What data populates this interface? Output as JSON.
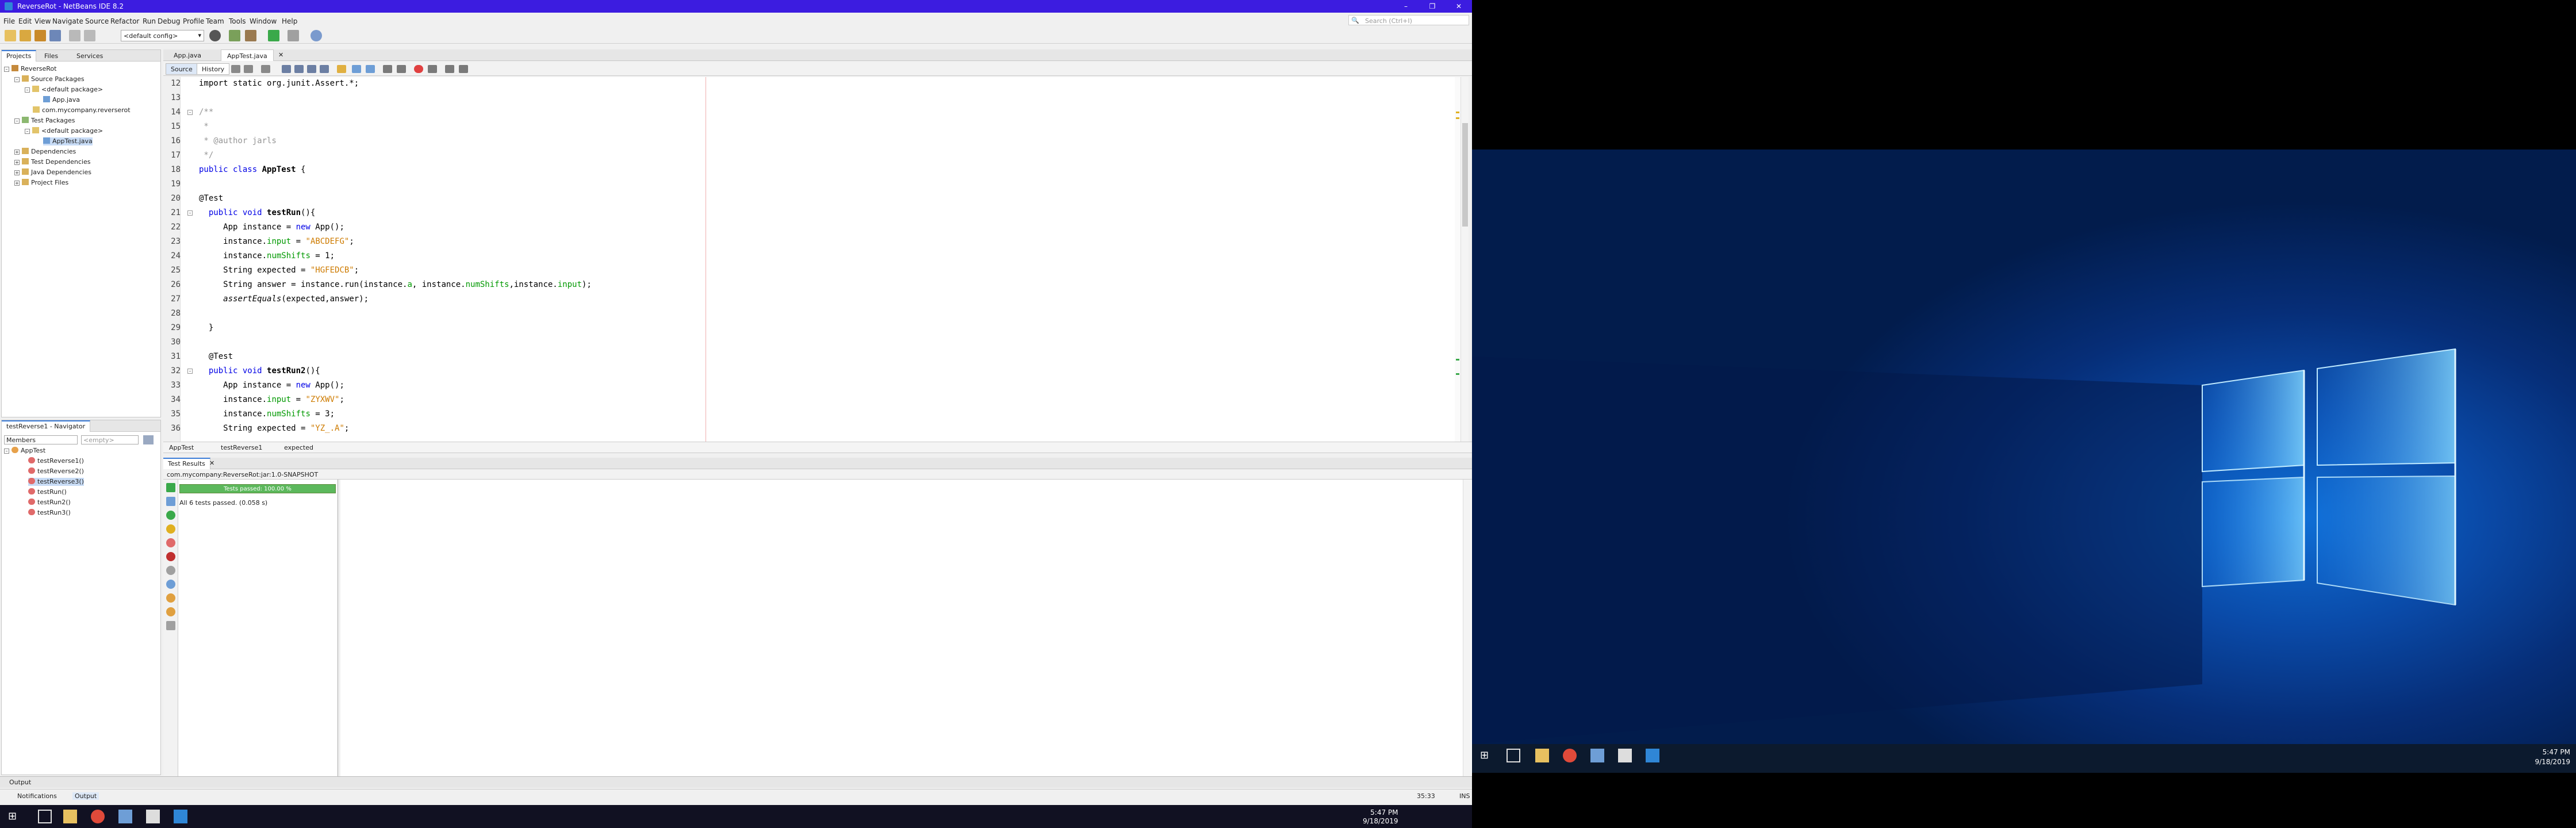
{
  "window": {
    "title": "ReverseRot - NetBeans IDE 8.2"
  },
  "menu": [
    "File",
    "Edit",
    "View",
    "Navigate",
    "Source",
    "Refactor",
    "Run",
    "Debug",
    "Profile",
    "Team",
    "Tools",
    "Window",
    "Help"
  ],
  "search": {
    "placeholder": "Search (Ctrl+I)"
  },
  "toolbar": {
    "config": "<default config>"
  },
  "projects": {
    "tabs": [
      "Projects",
      "Files",
      "Services"
    ],
    "tree": [
      {
        "label": "ReverseRot",
        "depth": 0
      },
      {
        "label": "Source Packages",
        "depth": 1
      },
      {
        "label": "<default package>",
        "depth": 2
      },
      {
        "label": "App.java",
        "depth": 3
      },
      {
        "label": "com.mycompany.reverserot",
        "depth": 2
      },
      {
        "label": "Test Packages",
        "depth": 1
      },
      {
        "label": "<default package>",
        "depth": 2
      },
      {
        "label": "AppTest.java",
        "depth": 3
      },
      {
        "label": "Dependencies",
        "depth": 1
      },
      {
        "label": "Test Dependencies",
        "depth": 1
      },
      {
        "label": "Java Dependencies",
        "depth": 1
      },
      {
        "label": "Project Files",
        "depth": 1
      }
    ]
  },
  "navigator": {
    "title": "testReverse1 - Navigator",
    "members_label": "Members",
    "filter": "<empty>",
    "root": "AppTest",
    "items": [
      "testReverse1()",
      "testReverse2()",
      "testReverse3()",
      "testRun()",
      "testRun2()",
      "testRun3()"
    ]
  },
  "editor": {
    "tabs": [
      "App.java",
      "AppTest.java"
    ],
    "source_tab": "Source",
    "history_tab": "History"
  },
  "code": [
    {
      "n": "12",
      "s": [
        [
          "",
          "import static org.junit.Assert.*;"
        ]
      ]
    },
    {
      "n": "13",
      "s": []
    },
    {
      "n": "14",
      "s": [
        [
          "cm",
          "/**"
        ]
      ],
      "fold": true
    },
    {
      "n": "15",
      "s": [
        [
          "cm",
          " *"
        ]
      ]
    },
    {
      "n": "16",
      "s": [
        [
          "cm",
          " * @author jarls"
        ]
      ]
    },
    {
      "n": "17",
      "s": [
        [
          "cm",
          " */"
        ]
      ]
    },
    {
      "n": "18",
      "s": [
        [
          "kw",
          "public class "
        ],
        [
          "b",
          "AppTest"
        ],
        [
          "",
          " {"
        ]
      ]
    },
    {
      "n": "19",
      "s": []
    },
    {
      "n": "20",
      "s": [
        [
          "",
          "@Test"
        ]
      ]
    },
    {
      "n": "21",
      "s": [
        [
          "",
          "  "
        ],
        [
          "kw",
          "public void "
        ],
        [
          "b",
          "testRun"
        ],
        [
          "",
          "(){"
        ]
      ],
      "fold": true
    },
    {
      "n": "22",
      "s": [
        [
          "",
          "     App instance = "
        ],
        [
          "kw",
          "new"
        ],
        [
          "",
          " App();"
        ]
      ]
    },
    {
      "n": "23",
      "s": [
        [
          "",
          "     instance."
        ],
        [
          "fld",
          "input"
        ],
        [
          "",
          " = "
        ],
        [
          "str",
          "\"ABCDEFG\""
        ],
        [
          "",
          ";"
        ]
      ]
    },
    {
      "n": "24",
      "s": [
        [
          "",
          "     instance."
        ],
        [
          "fld",
          "numShifts"
        ],
        [
          "",
          " = 1;"
        ]
      ]
    },
    {
      "n": "25",
      "s": [
        [
          "",
          "     String expected = "
        ],
        [
          "str",
          "\"HGFEDCB\""
        ],
        [
          "",
          ";"
        ]
      ]
    },
    {
      "n": "26",
      "s": [
        [
          "",
          "     String answer = instance.run(instance."
        ],
        [
          "fld",
          "a"
        ],
        [
          "",
          ", instance."
        ],
        [
          "fld",
          "numShifts"
        ],
        [
          "",
          ",instance."
        ],
        [
          "fld",
          "input"
        ],
        [
          "",
          ");"
        ]
      ]
    },
    {
      "n": "27",
      "s": [
        [
          "",
          "     "
        ],
        [
          "it",
          "assertEquals"
        ],
        [
          "",
          "(expected,answer);"
        ]
      ]
    },
    {
      "n": "28",
      "s": []
    },
    {
      "n": "29",
      "s": [
        [
          "",
          "  }"
        ]
      ]
    },
    {
      "n": "30",
      "s": []
    },
    {
      "n": "31",
      "s": [
        [
          "",
          "  @Test"
        ]
      ]
    },
    {
      "n": "32",
      "s": [
        [
          "",
          "  "
        ],
        [
          "kw",
          "public void "
        ],
        [
          "b",
          "testRun2"
        ],
        [
          "",
          "(){"
        ]
      ],
      "fold": true
    },
    {
      "n": "33",
      "s": [
        [
          "",
          "     App instance = "
        ],
        [
          "kw",
          "new"
        ],
        [
          "",
          " App();"
        ]
      ]
    },
    {
      "n": "34",
      "s": [
        [
          "",
          "     instance."
        ],
        [
          "fld",
          "input"
        ],
        [
          "",
          " = "
        ],
        [
          "str",
          "\"ZYXWV\""
        ],
        [
          "",
          ";"
        ]
      ]
    },
    {
      "n": "35",
      "s": [
        [
          "",
          "     instance."
        ],
        [
          "fld",
          "numShifts"
        ],
        [
          "",
          " = 3;"
        ]
      ]
    },
    {
      "n": "36",
      "s": [
        [
          "",
          "     String expected = "
        ],
        [
          "str",
          "\"YZ_.A\""
        ],
        [
          "",
          ";"
        ]
      ]
    }
  ],
  "breadcrumb": [
    "AppTest",
    "testReverse1",
    "expected"
  ],
  "test_results": {
    "title": "Test Results",
    "session": "com.mycompany:ReverseRot:jar:1.0-SNAPSHOT",
    "progress_text": "Tests passed: 100.00 %",
    "progress": 1.0,
    "summary": "All 6 tests passed. (0.058 s)"
  },
  "output": {
    "title": "Output",
    "notifications": "Notifications",
    "output_tab": "Output"
  },
  "status": {
    "position": "35:33",
    "mode": "INS"
  },
  "taskbar": {
    "time": "5:47 PM",
    "date": "9/18/2019"
  },
  "colors": {
    "title_bar": "#3c1ce0",
    "pass": "#5cb85c",
    "keyword": "#0000e6",
    "string": "#ce7b00",
    "field": "#009900",
    "comment": "#969696"
  }
}
